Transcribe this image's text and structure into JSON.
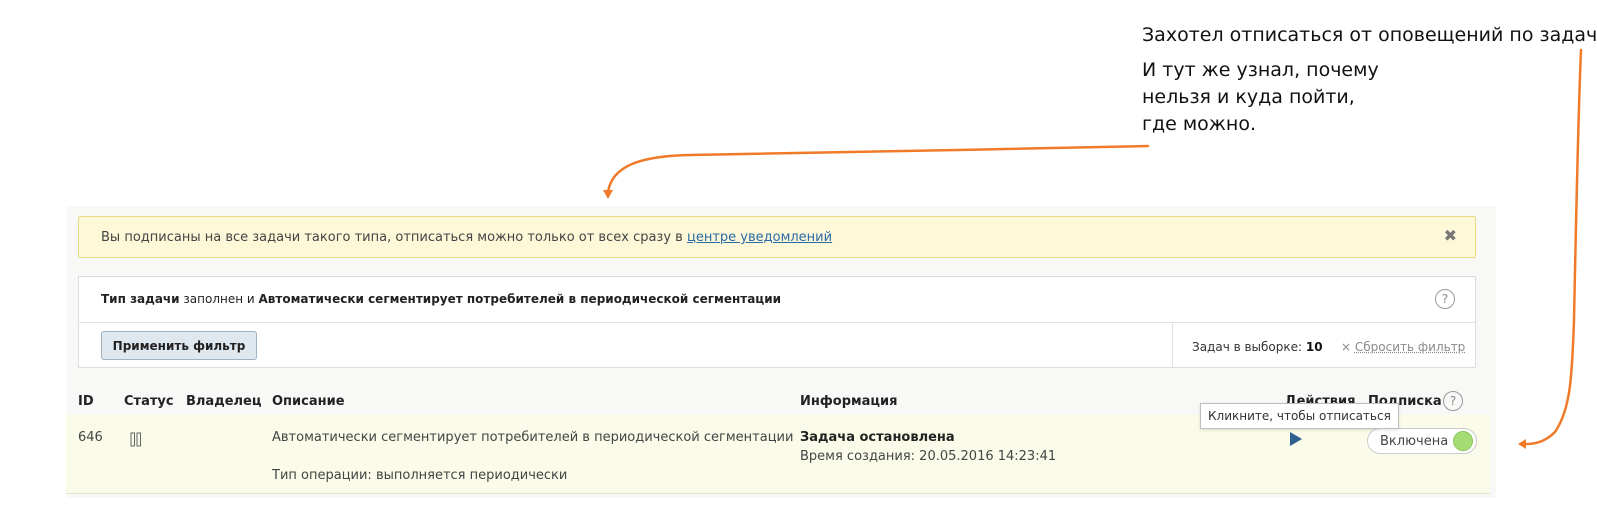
{
  "annotation": {
    "line1": "Захотел отписаться от оповещений по задаче",
    "line2": "И тут же узнал, почему нельзя и куда пойти, где можно."
  },
  "notice": {
    "text": "Вы подписаны на все задачи такого типа, отписаться можно только от всех сразу в ",
    "link": "центре уведомлений",
    "close_icon": "close-icon"
  },
  "filter": {
    "field1": "Тип задачи",
    "connector": " заполнен и ",
    "field2": "Автоматически сегментирует потребителей в периодической сегментации",
    "help": "?",
    "apply_label": "Применить фильтр",
    "count_label": "Задач в выборке: ",
    "count_value": "10",
    "reset_prefix": "× ",
    "reset_label": "Сбросить фильтр"
  },
  "table": {
    "headers": {
      "id": "ID",
      "status": "Статус",
      "owner": "Владелец",
      "description": "Описание",
      "info": "Информация",
      "actions": "Действия",
      "subscription": "Подписка",
      "help": "?"
    },
    "rows": [
      {
        "id": "646",
        "status_icon": "pause-icon",
        "owner": "",
        "description": "Автоматически сегментирует потребителей в периодической сегментации",
        "operation": "Тип операции: выполняется периодически",
        "info_title": "Задача остановлена",
        "info_created": "Время создания: 20.05.2016 14:23:41",
        "action_icon": "play-icon",
        "subscription": "Включена"
      }
    ]
  },
  "tooltip": "Кликните, чтобы отписаться",
  "colors": {
    "accent_arrow": "#f07a28",
    "notice_bg": "#fcf8d8",
    "toggle_on": "#a6dc74",
    "link": "#2b6aa6"
  }
}
